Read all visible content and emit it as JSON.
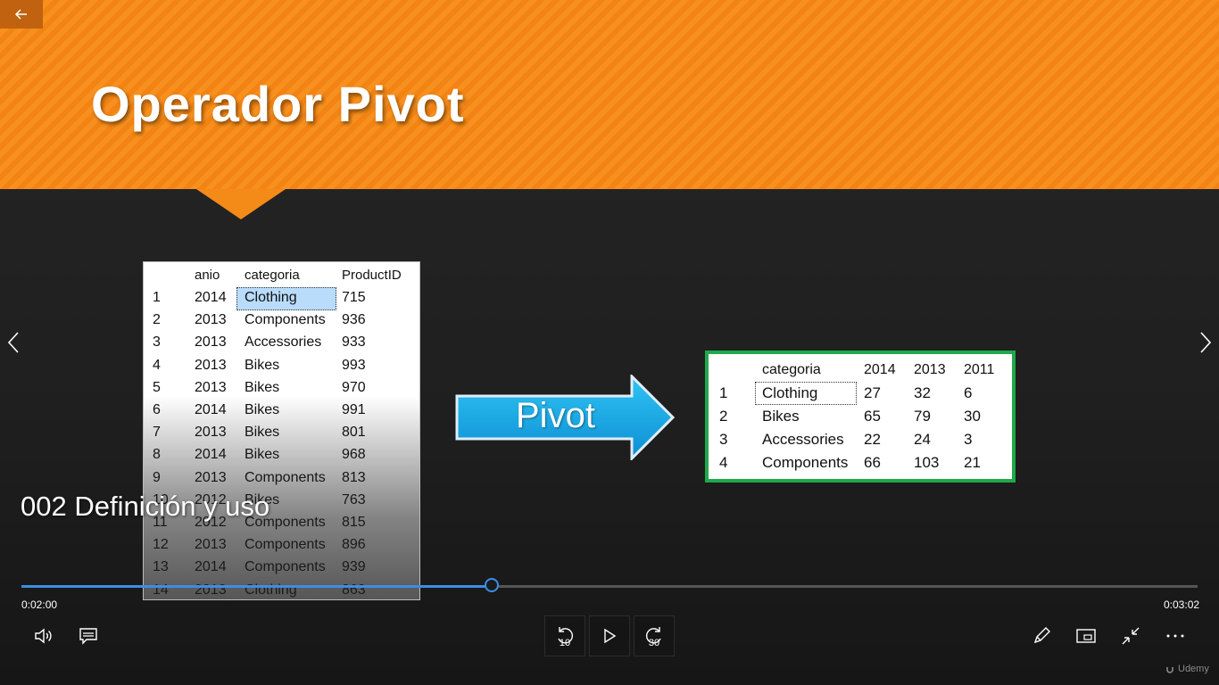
{
  "slide": {
    "title": "Operador Pivot",
    "source_table": {
      "headers": [
        "anio",
        "categoria",
        "ProductID"
      ],
      "rows": [
        [
          "1",
          "2014",
          "Clothing",
          "715"
        ],
        [
          "2",
          "2013",
          "Components",
          "936"
        ],
        [
          "3",
          "2013",
          "Accessories",
          "933"
        ],
        [
          "4",
          "2013",
          "Bikes",
          "993"
        ],
        [
          "5",
          "2013",
          "Bikes",
          "970"
        ],
        [
          "6",
          "2014",
          "Bikes",
          "991"
        ],
        [
          "7",
          "2013",
          "Bikes",
          "801"
        ],
        [
          "8",
          "2014",
          "Bikes",
          "968"
        ],
        [
          "9",
          "2013",
          "Components",
          "813"
        ],
        [
          "10",
          "2012",
          "Bikes",
          "763"
        ],
        [
          "11",
          "2012",
          "Components",
          "815"
        ],
        [
          "12",
          "2013",
          "Components",
          "896"
        ],
        [
          "13",
          "2014",
          "Components",
          "939"
        ],
        [
          "14",
          "2013",
          "Clothing",
          "863"
        ]
      ]
    },
    "arrow_label": "Pivot",
    "pivot_table": {
      "headers": [
        "categoria",
        "2014",
        "2013",
        "2011"
      ],
      "rows": [
        [
          "1",
          "Clothing",
          "27",
          "32",
          "6"
        ],
        [
          "2",
          "Bikes",
          "65",
          "79",
          "30"
        ],
        [
          "3",
          "Accessories",
          "22",
          "24",
          "3"
        ],
        [
          "4",
          "Components",
          "66",
          "103",
          "21"
        ]
      ]
    }
  },
  "player": {
    "video_title": "002 Definición y uso",
    "current_time": "0:02:00",
    "duration": "0:03:02",
    "progress_fraction": 0.4,
    "skip_back": "10",
    "skip_forward": "30",
    "brand": "Udemy",
    "accent_color": "#3a8ee6"
  }
}
